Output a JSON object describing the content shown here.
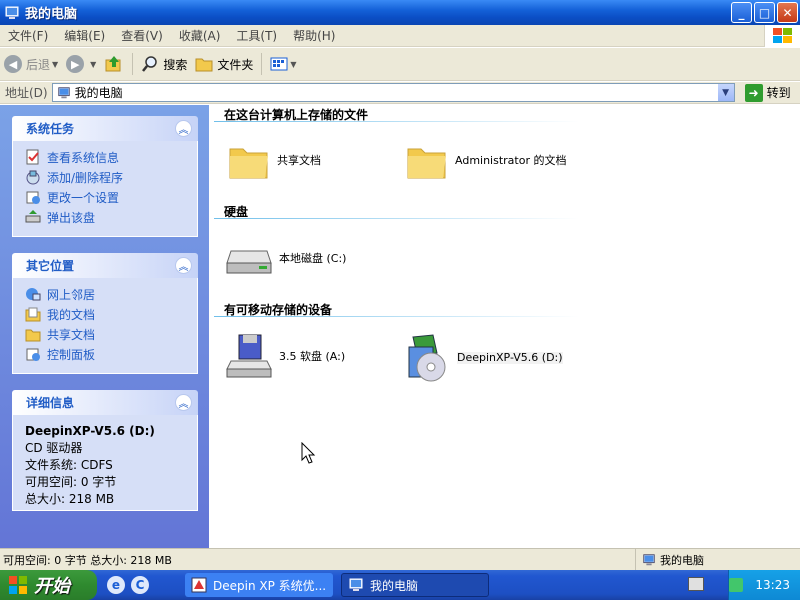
{
  "window": {
    "title": "我的电脑",
    "buttons": {
      "minimize": "_",
      "maximize": "□",
      "close": "✕"
    }
  },
  "menu": [
    "文件(F)",
    "编辑(E)",
    "查看(V)",
    "收藏(A)",
    "工具(T)",
    "帮助(H)"
  ],
  "toolbar": {
    "back": "后退",
    "search": "搜索",
    "folders": "文件夹"
  },
  "address": {
    "label": "地址(D)",
    "value": "我的电脑",
    "go": "转到"
  },
  "sidebar": {
    "system_tasks": {
      "title": "系统任务",
      "items": [
        "查看系统信息",
        "添加/删除程序",
        "更改一个设置",
        "弹出该盘"
      ]
    },
    "other_places": {
      "title": "其它位置",
      "items": [
        "网上邻居",
        "我的文档",
        "共享文档",
        "控制面板"
      ]
    },
    "details": {
      "title": "详细信息",
      "name": "DeepinXP-V5.6 (D:)",
      "type": "CD 驱动器",
      "fs": "文件系统: CDFS",
      "free": "可用空间: 0 字节",
      "total": "总大小: 218 MB"
    }
  },
  "content": {
    "groups": [
      {
        "title": "在这台计算机上存储的文件",
        "items": [
          "共享文档",
          "Administrator 的文档"
        ]
      },
      {
        "title": "硬盘",
        "items": [
          "本地磁盘 (C:)"
        ]
      },
      {
        "title": "有可移动存储的设备",
        "items": [
          "3.5 软盘 (A:)",
          "DeepinXP-V5.6 (D:)"
        ]
      }
    ]
  },
  "statusbar": {
    "left": "可用空间: 0 字节 总大小: 218 MB",
    "right": "我的电脑"
  },
  "taskbar": {
    "start": "开始",
    "tasks": [
      "Deepin XP 系统优...",
      "我的电脑"
    ],
    "clock": "13:23"
  },
  "colors": {
    "accent": "#215dc6",
    "titlebar": "#0b4ec5",
    "sidebar_bg": "#6375d6"
  }
}
